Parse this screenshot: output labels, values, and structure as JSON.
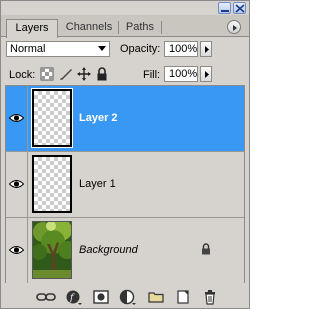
{
  "tabs": [
    {
      "label": "Layers",
      "active": true
    },
    {
      "label": "Channels",
      "active": false
    },
    {
      "label": "Paths",
      "active": false
    }
  ],
  "blend_mode": {
    "value": "Normal"
  },
  "opacity": {
    "label": "Opacity:",
    "value": "100%"
  },
  "lock": {
    "label": "Lock:"
  },
  "fill": {
    "label": "Fill:",
    "value": "100%"
  },
  "layers": [
    {
      "name": "Layer 2",
      "selected": true,
      "visible": true
    },
    {
      "name": "Layer 1",
      "selected": false,
      "visible": true
    },
    {
      "name": "Background",
      "selected": false,
      "visible": true,
      "locked": true
    }
  ],
  "colors": {
    "panel_bg": "#d6d3ce",
    "selection": "#3a98f5"
  },
  "icons": {
    "window": [
      "minimize-icon",
      "close-icon"
    ],
    "panel_menu": "panel-menu-arrow-icon",
    "lock_row": [
      "lock-transparent-pixels-icon",
      "lock-image-pixels-icon",
      "lock-position-icon",
      "lock-all-icon"
    ],
    "toolbar": [
      "link-layers-icon",
      "layer-style-icon",
      "layer-mask-icon",
      "adjustment-layer-icon",
      "new-group-icon",
      "new-layer-icon",
      "delete-layer-icon"
    ]
  }
}
